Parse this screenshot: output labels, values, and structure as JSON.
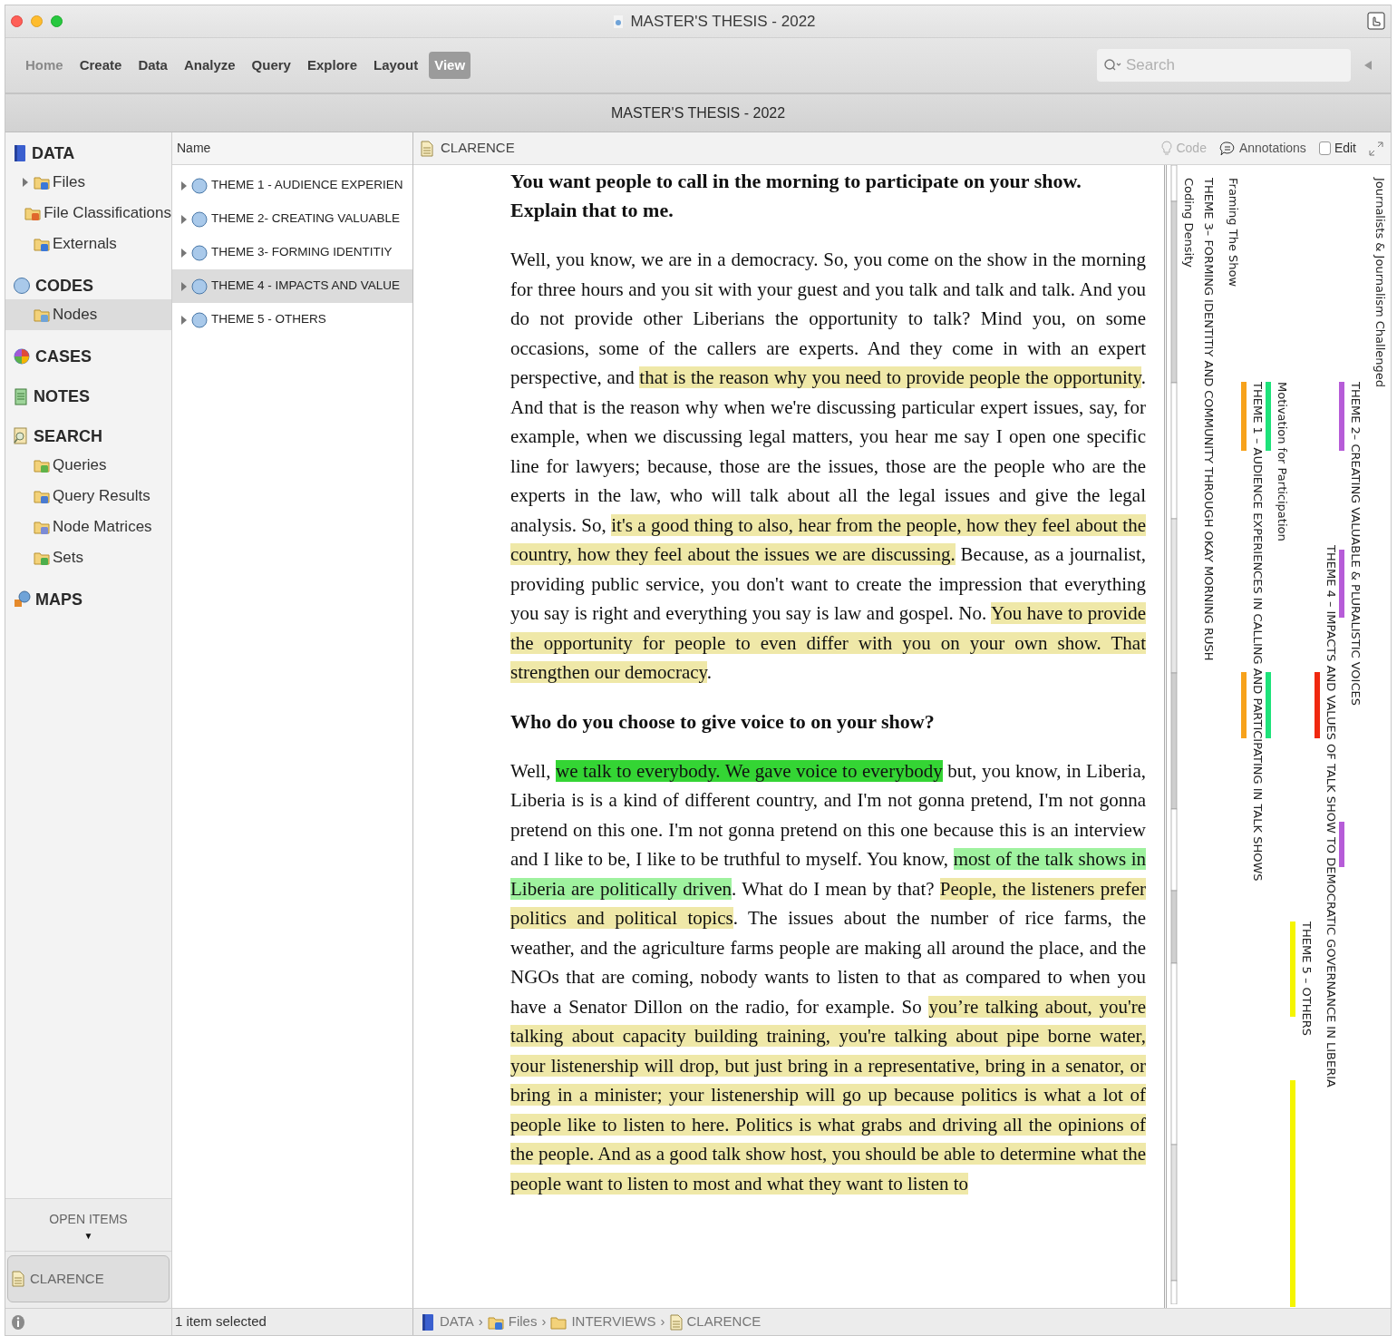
{
  "window": {
    "title": "MASTER'S THESIS - 2022"
  },
  "ribbon_tabs": [
    {
      "label": "Home",
      "selected": false,
      "disabled": true
    },
    {
      "label": "Create",
      "selected": false,
      "disabled": false
    },
    {
      "label": "Data",
      "selected": false,
      "disabled": false
    },
    {
      "label": "Analyze",
      "selected": false,
      "disabled": false
    },
    {
      "label": "Query",
      "selected": false,
      "disabled": false
    },
    {
      "label": "Explore",
      "selected": false,
      "disabled": false
    },
    {
      "label": "Layout",
      "selected": false,
      "disabled": false
    },
    {
      "label": "View",
      "selected": true,
      "disabled": false
    }
  ],
  "search": {
    "placeholder": "Search"
  },
  "project_bar": {
    "title": "MASTER'S THESIS - 2022"
  },
  "navigation": [
    {
      "label": "DATA",
      "kind": "data",
      "children": [
        {
          "label": "Files",
          "kind": "files",
          "expandable": true,
          "selected": false
        },
        {
          "label": "File Classifications",
          "kind": "classifications",
          "expandable": false,
          "selected": false
        },
        {
          "label": "Externals",
          "kind": "externals",
          "expandable": false,
          "selected": false
        }
      ]
    },
    {
      "label": "CODES",
      "kind": "codes",
      "children": [
        {
          "label": "Nodes",
          "kind": "nodes",
          "expandable": false,
          "selected": true
        }
      ]
    },
    {
      "label": "CASES",
      "kind": "cases"
    },
    {
      "label": "NOTES",
      "kind": "notes"
    },
    {
      "label": "SEARCH",
      "kind": "search",
      "children": [
        {
          "label": "Queries",
          "kind": "queries",
          "expandable": false,
          "selected": false
        },
        {
          "label": "Query Results",
          "kind": "results",
          "expandable": false,
          "selected": false
        },
        {
          "label": "Node Matrices",
          "kind": "matrices",
          "expandable": false,
          "selected": false
        },
        {
          "label": "Sets",
          "kind": "sets",
          "expandable": false,
          "selected": false
        }
      ]
    },
    {
      "label": "MAPS",
      "kind": "maps"
    }
  ],
  "open_items": {
    "title": "OPEN ITEMS",
    "toggle": "▼",
    "items": [
      {
        "label": "CLARENCE"
      }
    ]
  },
  "node_list": {
    "column": "Name",
    "rows": [
      {
        "label": "THEME 1 - AUDIENCE EXPERIEN",
        "selected": false
      },
      {
        "label": "THEME 2- CREATING VALUABLE",
        "selected": false
      },
      {
        "label": "THEME 3- FORMING IDENTITIY",
        "selected": false
      },
      {
        "label": "THEME 4 - IMPACTS AND VALUE",
        "selected": true
      },
      {
        "label": "THEME 5 - OTHERS",
        "selected": false
      }
    ]
  },
  "document": {
    "title": "CLARENCE",
    "toolbar": [
      {
        "kind": "code",
        "label": "Code",
        "disabled": true
      },
      {
        "kind": "annotations",
        "label": "Annotations",
        "disabled": false
      },
      {
        "kind": "edit",
        "label": "Edit",
        "checked": false
      }
    ],
    "paragraphs": [
      {
        "kind": "question",
        "segments": [
          {
            "text": "You want people to call in the morning to participate on your show. Explain that to me."
          }
        ]
      },
      {
        "kind": "answer",
        "segments": [
          {
            "text": "Well, you know, we are in  a democracy. So, you come on the show in the morning for three hours and you sit with your guest  and you talk and talk and talk. And you do not provide other Liberians the opportunity to talk? Mind you, on some occasions, some of the callers are experts. And they come in with an expert perspective, and "
          },
          {
            "text": "that is the reason why you need to provide people the opportunity",
            "color": "#efe8a8"
          },
          {
            "text": ". And that is the reason why when we're discussing particular expert issues, say, for example, when we discussing legal matters, you hear me say I open one specific line for lawyers; because, those are the issues, those are the people who are the experts in the law, who  will talk about all the legal issues and give the legal analysis. So, "
          },
          {
            "text": "it's a good thing to also, hear from the people, how they feel about the country, how they feel about the issues we are discussing.",
            "color": "#efe8a8"
          },
          {
            "text": " Because, as a journalist, providing public service, you don't want to create the impression that everything you say is right and everything you say is law and gospel. No. "
          },
          {
            "text": "You have to provide the opportunity for people to even differ with you on your own show. That strengthen our democracy",
            "color": "#efe8a8"
          },
          {
            "text": "."
          }
        ]
      },
      {
        "kind": "question",
        "segments": [
          {
            "text": "Who do you choose to give voice to on your show?"
          }
        ]
      },
      {
        "kind": "answer",
        "segments": [
          {
            "text": "Well,  "
          },
          {
            "text": "we talk to everybody. We gave voice to everybody",
            "color": "#34d534"
          },
          {
            "text": " but, you know, in Liberia, Liberia is is a kind of different country, and I'm not gonna pretend, I'm not gonna pretend on this one. I'm not gonna pretend on this one because this is an interview and I like to be, I like to be truthful to myself. You know, "
          },
          {
            "text": "most of the talk shows in Liberia are politically driven",
            "color": "#9ff29f"
          },
          {
            "text": ". What do I mean by that? "
          },
          {
            "text": "People, the listeners prefer politics and political topics",
            "color": "#efe8a8"
          },
          {
            "text": ". The issues about the number of rice farms, the weather, and the agriculture farms people are making all around the place, and the NGOs that are coming, nobody wants to listen to that as compared to when you have a Senator Dillon on the radio, for example. So "
          },
          {
            "text": "you’re talking about, you're talking about capacity building training, you're talking about pipe borne water,  your listenership will drop, but just bring in a representative, bring in a senator, or bring in a minister; your listenership will go up because politics is what a lot of people like to listen to here. Politics is what grabs and driving all the opinions of the people. And as a good talk show host, you should be able to determine what the people want to listen to most and what they want to listen to",
            "color": "#efe8a8"
          }
        ]
      }
    ]
  },
  "coding_stripes": [
    {
      "kind": "density",
      "label": "Coding Density"
    },
    {
      "kind": "code",
      "label": "THEME 3– FORMING IDENTITIY AND COMMUNITY THROUGH OKAY MORNING RUSH"
    },
    {
      "kind": "code",
      "label": "Framing The Show"
    },
    {
      "kind": "code",
      "label": "THEME 1 – AUDIENCE EXPERIENCES IN CALLING AND PARTICIPATING IN TALK SHOWS",
      "color": "#f7a21b"
    },
    {
      "kind": "code",
      "label": "Motivation for Participation",
      "color": "#1de27a"
    },
    {
      "kind": "code",
      "label": "THEME 5 – OTHERS",
      "color": "#f5f500"
    },
    {
      "kind": "code",
      "label": "THEME 4 – IMPACTS AND VALUES OF TALK SHOW TO DEMOCRATIC GOVERNANCE IN LIBERIA",
      "color": "#f0280f"
    },
    {
      "kind": "code",
      "label": "THEME 2– CREATING VALUABLE & PLURALISTIC VOICES",
      "color": "#b65cd8"
    },
    {
      "kind": "code",
      "label": "Journalists & Journalism Challenged"
    }
  ],
  "status_bar": {
    "selection": "1 item selected",
    "breadcrumb": [
      {
        "label": "DATA",
        "kind": "data",
        "separator": "›"
      },
      {
        "label": "Files",
        "kind": "files",
        "separator": "›"
      },
      {
        "label": "INTERVIEWS",
        "kind": "folder",
        "separator": "›"
      },
      {
        "label": "CLARENCE",
        "kind": "document"
      }
    ]
  }
}
